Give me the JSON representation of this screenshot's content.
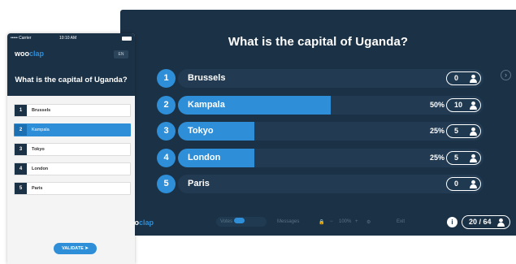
{
  "presenter": {
    "question": "What is the capital of Uganda?",
    "answers": [
      {
        "num": "1",
        "label": "Brussels",
        "share": 0,
        "percent": "",
        "count": "0"
      },
      {
        "num": "2",
        "label": "Kampala",
        "share": 50,
        "percent": "50%",
        "count": "10"
      },
      {
        "num": "3",
        "label": "Tokyo",
        "share": 25,
        "percent": "25%",
        "count": "5"
      },
      {
        "num": "4",
        "label": "London",
        "share": 25,
        "percent": "25%",
        "count": "5"
      },
      {
        "num": "5",
        "label": "Paris",
        "share": 0,
        "percent": "",
        "count": "0"
      }
    ],
    "footer": {
      "brand_left": "oo",
      "brand_right": "clap",
      "votes_label": "Votes",
      "messages_label": "Messages",
      "zoom_label": "100%",
      "exit_label": "Exit",
      "info_icon_text": "i",
      "counter": "20 / 64"
    },
    "colors": {
      "background": "#1b3145",
      "accent": "#2e8fd8",
      "bar_track": "#223b52"
    }
  },
  "phone": {
    "status": {
      "carrier": "••••• Carrier",
      "time": "10:10 AM"
    },
    "logo_left": "woo",
    "logo_right": "clap",
    "lang": "EN",
    "question": "What is the capital of Uganda?",
    "choices": [
      {
        "num": "1",
        "label": "Brussels",
        "selected": false
      },
      {
        "num": "2",
        "label": "Kampala",
        "selected": true
      },
      {
        "num": "3",
        "label": "Tokyo",
        "selected": false
      },
      {
        "num": "4",
        "label": "London",
        "selected": false
      },
      {
        "num": "5",
        "label": "Paris",
        "selected": false
      }
    ],
    "validate_label": "VALIDATE"
  }
}
